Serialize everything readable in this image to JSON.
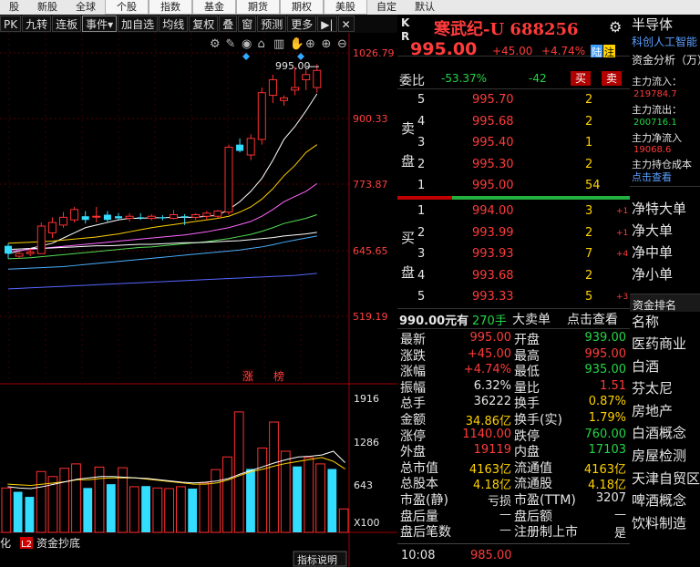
{
  "menu": [
    "股",
    "新股",
    "全球",
    "个股",
    "指数",
    "基金",
    "期货",
    "期权",
    "美股",
    "自定",
    "默认"
  ],
  "toolbar": [
    "PK",
    "九转",
    "连板",
    "事件▾",
    "加自选",
    "均线",
    "复权",
    "叠",
    "窗",
    "预测",
    "更多",
    "▶|",
    "✕"
  ],
  "chart_icons": [
    "gear-icon",
    "pen-icon",
    "eye-icon",
    "home-icon",
    "trash-icon",
    "hand-icon",
    "plus-icon",
    "zoom-in-icon",
    "zoom-out-icon"
  ],
  "price_axis": [
    "1026.79",
    "900.33",
    "773.87",
    "645.65",
    "519.19"
  ],
  "vol_axis": [
    "1916",
    "1286",
    "643",
    "X100"
  ],
  "max_label": "995.00",
  "markers": [
    "涨",
    "榜"
  ],
  "chart_bottom": {
    "tab1": "化",
    "tab2_icon": "L2",
    "tab2": "资金抄底",
    "btn": "指标说明"
  },
  "chart_data": {
    "type": "candlestick",
    "y_range": [
      519.19,
      1026.79
    ],
    "candles": [
      {
        "o": 655,
        "h": 660,
        "l": 630,
        "c": 640
      },
      {
        "o": 635,
        "h": 645,
        "l": 630,
        "c": 640
      },
      {
        "o": 640,
        "h": 650,
        "l": 635,
        "c": 643
      },
      {
        "o": 640,
        "h": 700,
        "l": 640,
        "c": 693
      },
      {
        "o": 680,
        "h": 710,
        "l": 670,
        "c": 700
      },
      {
        "o": 695,
        "h": 720,
        "l": 690,
        "c": 710
      },
      {
        "o": 705,
        "h": 730,
        "l": 700,
        "c": 725
      },
      {
        "o": 712,
        "h": 722,
        "l": 698,
        "c": 705
      },
      {
        "o": 712,
        "h": 730,
        "l": 700,
        "c": 712
      },
      {
        "o": 715,
        "h": 722,
        "l": 700,
        "c": 705
      },
      {
        "o": 712,
        "h": 718,
        "l": 705,
        "c": 708
      },
      {
        "o": 708,
        "h": 718,
        "l": 702,
        "c": 712
      },
      {
        "o": 710,
        "h": 718,
        "l": 705,
        "c": 708
      },
      {
        "o": 708,
        "h": 716,
        "l": 704,
        "c": 712
      },
      {
        "o": 710,
        "h": 714,
        "l": 704,
        "c": 708
      },
      {
        "o": 708,
        "h": 724,
        "l": 706,
        "c": 715
      },
      {
        "o": 712,
        "h": 716,
        "l": 695,
        "c": 710
      },
      {
        "o": 710,
        "h": 718,
        "l": 705,
        "c": 715
      },
      {
        "o": 712,
        "h": 722,
        "l": 705,
        "c": 718
      },
      {
        "o": 712,
        "h": 724,
        "l": 708,
        "c": 722
      },
      {
        "o": 720,
        "h": 850,
        "l": 715,
        "c": 845
      },
      {
        "o": 850,
        "h": 862,
        "l": 835,
        "c": 838
      },
      {
        "o": 830,
        "h": 870,
        "l": 820,
        "c": 862
      },
      {
        "o": 860,
        "h": 960,
        "l": 850,
        "c": 950
      },
      {
        "o": 945,
        "h": 985,
        "l": 930,
        "c": 975
      },
      {
        "o": 935,
        "h": 945,
        "l": 925,
        "c": 940
      },
      {
        "o": 955,
        "h": 1000,
        "l": 945,
        "c": 960
      },
      {
        "o": 975,
        "h": 995,
        "l": 955,
        "c": 985
      },
      {
        "o": 960,
        "h": 1005,
        "l": 950,
        "c": 993
      }
    ],
    "ma": [
      {
        "color": "#ffffff",
        "values": [
          640,
          645,
          650,
          655,
          660,
          670,
          680,
          690,
          695,
          700,
          705,
          708,
          708,
          709,
          709,
          710,
          710,
          710,
          712,
          714,
          725,
          740,
          760,
          785,
          820,
          860,
          885,
          915,
          948
        ]
      },
      {
        "color": "#ffd200",
        "values": [
          660,
          661,
          662,
          663,
          664,
          666,
          668,
          670,
          672,
          675,
          678,
          682,
          686,
          690,
          693,
          696,
          699,
          702,
          705,
          708,
          712,
          720,
          730,
          745,
          765,
          790,
          810,
          835,
          850
        ]
      },
      {
        "color": "#ff66ff",
        "values": [
          645,
          646,
          648,
          650,
          652,
          654,
          656,
          658,
          660,
          662,
          664,
          666,
          668,
          670,
          672,
          674,
          676,
          679,
          682,
          686,
          690,
          696,
          702,
          712,
          725,
          740,
          750,
          760,
          775
        ]
      },
      {
        "color": "#55dd55",
        "values": [
          630,
          631,
          632,
          634,
          636,
          638,
          640,
          642,
          644,
          646,
          648,
          650,
          652,
          653,
          655,
          657,
          659,
          661,
          663,
          666,
          669,
          673,
          677,
          683,
          690,
          698,
          703,
          708,
          715
        ]
      },
      {
        "color": "#4ab0ff",
        "values": [
          610,
          611,
          612,
          613,
          614,
          615,
          617,
          619,
          621,
          623,
          625,
          627,
          629,
          631,
          633,
          635,
          637,
          639,
          641,
          643,
          645,
          647,
          650,
          653,
          657,
          662,
          666,
          670,
          674
        ]
      },
      {
        "color": "#ffffff",
        "values": [
          648,
          649,
          650,
          650,
          651,
          652,
          653,
          654,
          655,
          655,
          656,
          657,
          658,
          658,
          659,
          660,
          661,
          661,
          662,
          663,
          664,
          665,
          667,
          669,
          671,
          674,
          676,
          678,
          681
        ]
      },
      {
        "color": "#5566ff",
        "values": [
          572,
          573,
          574,
          575,
          576,
          577,
          578,
          579,
          580,
          581,
          582,
          583,
          584,
          585,
          586,
          587,
          588,
          589,
          590,
          591,
          592,
          593,
          594,
          595,
          596,
          597,
          598,
          600,
          602
        ]
      }
    ],
    "volume_range": [
      0,
      2200
    ],
    "volume": [
      700,
      640,
      560,
      960,
      880,
      1010,
      1080,
      700,
      1030,
      760,
      1020,
      720,
      730,
      700,
      690,
      720,
      690,
      780,
      990,
      1190,
      1900,
      1000,
      1330,
      1740,
      1280,
      1040,
      1180,
      1080,
      1000,
      370
    ],
    "volume_up": [
      true,
      false,
      false,
      true,
      true,
      true,
      true,
      false,
      true,
      false,
      true,
      true,
      false,
      true,
      true,
      true,
      false,
      true,
      true,
      true,
      true,
      false,
      true,
      true,
      true,
      false,
      true,
      true,
      false,
      true
    ],
    "vol_ma": [
      {
        "color": "#ffd200",
        "values": [
          760,
          750,
          740,
          760,
          780,
          800,
          830,
          830,
          850,
          860,
          860,
          860,
          840,
          820,
          800,
          780,
          760,
          760,
          780,
          830,
          900,
          960,
          1000,
          1050,
          1090,
          1120,
          1150,
          1180,
          1120,
          1000
        ]
      },
      {
        "color": "#ffffff",
        "values": [
          720,
          700,
          690,
          720,
          760,
          800,
          840,
          860,
          880,
          880,
          870,
          860,
          850,
          830,
          810,
          790,
          780,
          790,
          810,
          850,
          920,
          980,
          1040,
          1100,
          1150,
          1190,
          1200,
          1220,
          1280,
          1100
        ]
      }
    ]
  },
  "quote": {
    "kr": [
      "K",
      "R"
    ],
    "name": "寒武纪-U 688256",
    "price": "995.00",
    "change": "+45.00",
    "pct": "+4.74%",
    "tag1": "陆",
    "tag2": "注",
    "webi_label": "委比",
    "webi_pct": "-53.37%",
    "webi_diff": "-42",
    "buy_btn": "买",
    "sell_btn": "卖",
    "sell_side_label": [
      "卖",
      "盘"
    ],
    "buy_side_label": [
      "买",
      "盘"
    ],
    "asks": [
      {
        "n": "5",
        "p": "995.70",
        "v": "2"
      },
      {
        "n": "4",
        "p": "995.68",
        "v": "2"
      },
      {
        "n": "3",
        "p": "995.40",
        "v": "1"
      },
      {
        "n": "2",
        "p": "995.30",
        "v": "2"
      },
      {
        "n": "1",
        "p": "995.00",
        "v": "54"
      }
    ],
    "bids": [
      {
        "n": "1",
        "p": "994.00",
        "v": "3",
        "d": "+1"
      },
      {
        "n": "2",
        "p": "993.99",
        "v": "2",
        "d": "+1"
      },
      {
        "n": "3",
        "p": "993.93",
        "v": "7",
        "d": "+4"
      },
      {
        "n": "4",
        "p": "993.68",
        "v": "2",
        "d": ""
      },
      {
        "n": "5",
        "p": "993.33",
        "v": "5",
        "d": "+3"
      }
    ],
    "big_order": {
      "price": "990.00元有",
      "vol": "270手",
      "title": "大卖单",
      "link": "点击查看"
    },
    "stats": [
      [
        "最新",
        "995.00",
        "red",
        "开盘",
        "939.00",
        "grn"
      ],
      [
        "涨跌",
        "+45.00",
        "red",
        "最高",
        "995.00",
        "red"
      ],
      [
        "涨幅",
        "+4.74%",
        "red",
        "最低",
        "935.00",
        "grn"
      ],
      [
        "振幅",
        "6.32%",
        "wht",
        "量比",
        "1.51",
        "red"
      ],
      [
        "总手",
        "36222",
        "wht",
        "换手",
        "0.87%",
        "yel"
      ],
      [
        "金额",
        "34.86亿",
        "yel",
        "换手(实)",
        "1.79%",
        "yel"
      ],
      [
        "涨停",
        "1140.00",
        "red",
        "跌停",
        "760.00",
        "grn"
      ],
      [
        "外盘",
        "19119",
        "red",
        "内盘",
        "17103",
        "grn"
      ],
      [
        "总市值",
        "4163亿",
        "yel",
        "流通值",
        "4163亿",
        "yel"
      ],
      [
        "总股本",
        "4.18亿",
        "yel",
        "流通股",
        "4.18亿",
        "yel"
      ],
      [
        "市盈(静)",
        "亏损",
        "wht",
        "市盈(TTM)",
        "3207",
        "wht"
      ],
      [
        "盘后量",
        "—",
        "wht",
        "盘后额",
        "—",
        "wht"
      ],
      [
        "盘后笔数",
        "—",
        "wht",
        "注册制上市",
        "是",
        "wht"
      ]
    ],
    "tick_time": "10:08",
    "tick_price": "985.00"
  },
  "side": {
    "sector": "半导体",
    "sector_sub": "科创人工智能",
    "fund_title": "资金分析（万）",
    "inflow_label": "主力流入：",
    "inflow_val": "219784.7",
    "outflow_label": "主力流出：",
    "outflow_val": "200716.1",
    "net_label": "主力净流入",
    "net_val": "19068.6",
    "cost_label": "主力持仓成本",
    "cost_link": "点击查看",
    "big_items": [
      "净特大单",
      "净大单",
      "净中单",
      "净小单"
    ],
    "rank_title": "资金排名",
    "rank_head": "名称",
    "rank_items": [
      "医药商业",
      "白酒",
      "芬太尼",
      "房地产",
      "白酒概念",
      "房屋检测",
      "天津自贸区",
      "啤酒概念",
      "饮料制造"
    ]
  }
}
